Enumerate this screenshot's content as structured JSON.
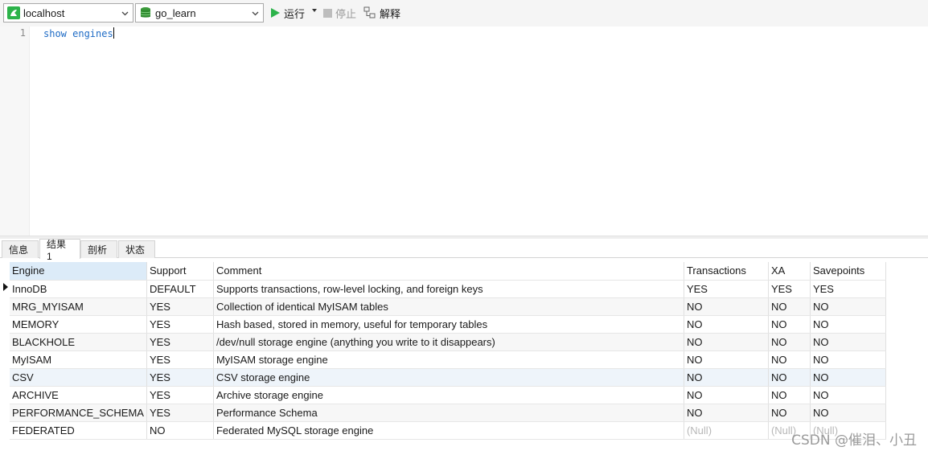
{
  "toolbar": {
    "connection": {
      "value": "localhost",
      "icon": "connection-icon"
    },
    "database": {
      "value": "go_learn",
      "icon": "database-icon"
    },
    "run_label": "运行",
    "stop_label": "停止",
    "explain_label": "解释"
  },
  "editor": {
    "line_number": "1",
    "query": "show engines"
  },
  "tabs": [
    "信息",
    "结果 1",
    "剖析",
    "状态"
  ],
  "active_tab": "结果 1",
  "result": {
    "columns": [
      "Engine",
      "Support",
      "Comment",
      "Transactions",
      "XA",
      "Savepoints"
    ],
    "rows": [
      [
        "InnoDB",
        "DEFAULT",
        "Supports transactions, row-level locking, and foreign keys",
        "YES",
        "YES",
        "YES"
      ],
      [
        "MRG_MYISAM",
        "YES",
        "Collection of identical MyISAM tables",
        "NO",
        "NO",
        "NO"
      ],
      [
        "MEMORY",
        "YES",
        "Hash based, stored in memory, useful for temporary tables",
        "NO",
        "NO",
        "NO"
      ],
      [
        "BLACKHOLE",
        "YES",
        "/dev/null storage engine (anything you write to it disappears)",
        "NO",
        "NO",
        "NO"
      ],
      [
        "MyISAM",
        "YES",
        "MyISAM storage engine",
        "NO",
        "NO",
        "NO"
      ],
      [
        "CSV",
        "YES",
        "CSV storage engine",
        "NO",
        "NO",
        "NO"
      ],
      [
        "ARCHIVE",
        "YES",
        "Archive storage engine",
        "NO",
        "NO",
        "NO"
      ],
      [
        "PERFORMANCE_SCHEMA",
        "YES",
        "Performance Schema",
        "NO",
        "NO",
        "NO"
      ],
      [
        "FEDERATED",
        "NO",
        "Federated MySQL storage engine",
        "(Null)",
        "(Null)",
        "(Null)"
      ]
    ]
  },
  "watermark": "CSDN @催泪、小丑",
  "colors": {
    "run_green": "#2cb34a",
    "db_green": "#3a9a3a",
    "code_blue": "#1e6bc5",
    "sorted_header": "#dcebf8"
  }
}
